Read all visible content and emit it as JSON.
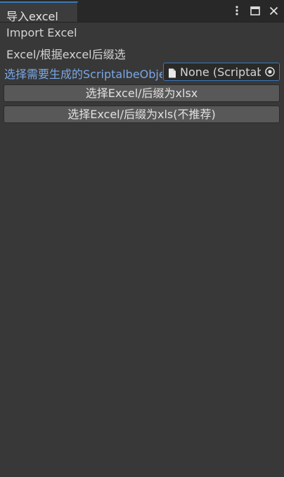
{
  "window": {
    "tab_title": "导入excel",
    "controls": [
      "more-icon",
      "maximize-icon",
      "close-icon"
    ]
  },
  "content": {
    "section_title": "Import Excel",
    "description": "Excel/根据excel后缀选",
    "object_field": {
      "label": "选择需要生成的ScriptalbeObject",
      "value": "None (Scriptable Object)",
      "icon": "file-icon",
      "picker_icon": "object-picker-icon"
    },
    "buttons": {
      "xlsx": "选择Excel/后缀为xlsx",
      "xls": "选择Excel/后缀为xls(不推荐)"
    }
  },
  "colors": {
    "background": "#383838",
    "tabbar": "#282828",
    "accent": "#3a79bb",
    "label_blue": "#7aa7e6",
    "button": "#585858"
  }
}
